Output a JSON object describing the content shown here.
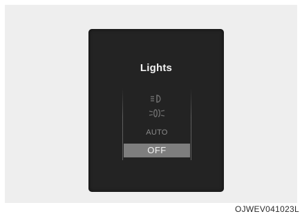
{
  "screen": {
    "title": "Lights",
    "options": [
      {
        "icon": "parking-light-icon",
        "selected": false
      },
      {
        "icon": "low-beam-icon",
        "selected": false
      },
      {
        "label": "AUTO",
        "selected": false
      },
      {
        "label": "OFF",
        "selected": true
      }
    ]
  },
  "figure_code": "OJWEV041023L"
}
